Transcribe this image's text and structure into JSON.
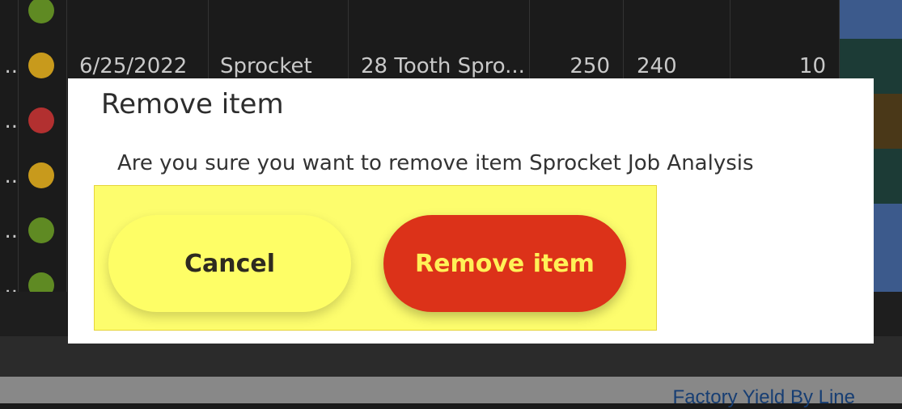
{
  "table": {
    "rows": [
      {
        "prefix": "",
        "status_color": "#5f8a23",
        "date": "",
        "category": "",
        "description": "",
        "n1": "",
        "n2": "",
        "n3": "",
        "row_color": "#3c5a8c"
      },
      {
        "prefix": "..",
        "status_color": "#c89a1c",
        "date": "6/25/2022",
        "category": "Sprocket",
        "description": "28 Tooth Spro...",
        "n1": "250",
        "n2": "240",
        "n3": "10",
        "row_color": "#1c3b36"
      },
      {
        "prefix": "..",
        "status_color": "#b23030",
        "date": "",
        "category": "",
        "description": "",
        "n1": "",
        "n2": "",
        "n3": "",
        "row_color": "#4a3818"
      },
      {
        "prefix": "..",
        "status_color": "#c89a1c",
        "date": "",
        "category": "",
        "description": "",
        "n1": "",
        "n2": "",
        "n3": "",
        "row_color": "#1c3b36"
      },
      {
        "prefix": "..",
        "status_color": "#5f8a23",
        "date": "",
        "category": "",
        "description": "",
        "n1": "",
        "n2": "",
        "n3": "",
        "row_color": "#3c5a8c"
      },
      {
        "prefix": "..",
        "status_color": "#5f8a23",
        "date": "",
        "category": "",
        "description": "",
        "n1": "",
        "n2": "",
        "n3": "",
        "row_color": "#3c5a8c"
      }
    ]
  },
  "footer": {
    "link_text": "Factory Yield By Line"
  },
  "dialog": {
    "title": "Remove item",
    "message": "Are you sure you want to remove item Sprocket Job Analysis",
    "cancel_label": "Cancel",
    "confirm_label": "Remove item"
  }
}
